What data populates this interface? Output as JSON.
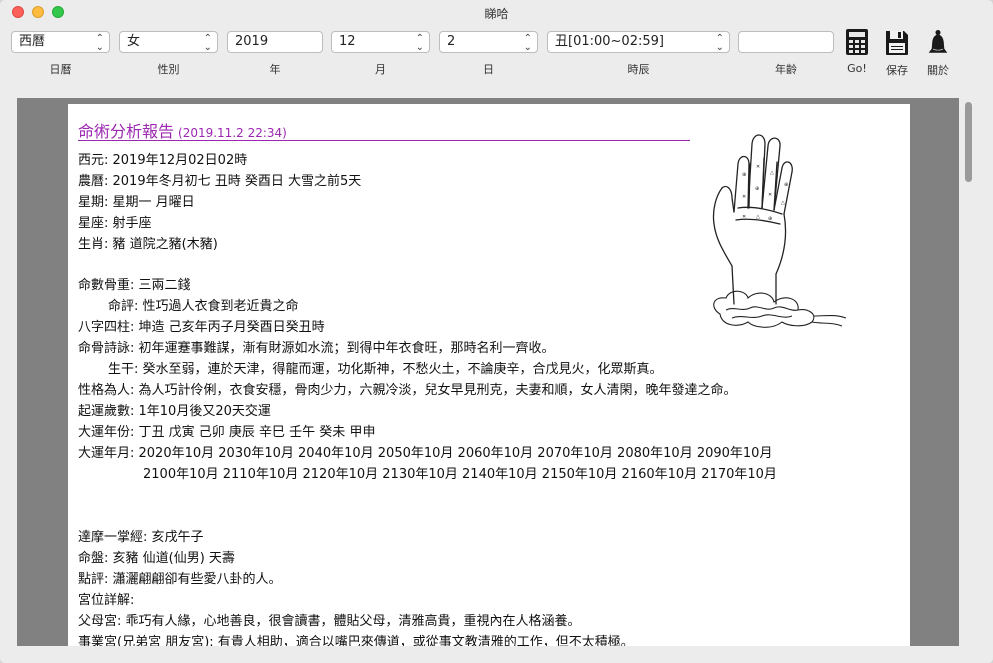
{
  "window": {
    "title": "睇哈"
  },
  "toolbar": {
    "calendar": {
      "value": "西曆",
      "label": "日曆"
    },
    "gender": {
      "value": "女",
      "label": "性別"
    },
    "year": {
      "value": "2019",
      "label": "年"
    },
    "month": {
      "value": "12",
      "label": "月"
    },
    "day": {
      "value": "2",
      "label": "日"
    },
    "hour": {
      "value": "丑[01:00~02:59]",
      "label": "時辰"
    },
    "age": {
      "value": "",
      "label": "年齡"
    },
    "go_label": "Go!",
    "save_label": "保存",
    "about_label": "關於",
    "icons": {
      "go": "calculator-icon",
      "save": "floppy-disk-icon",
      "about": "bell-icon"
    }
  },
  "report": {
    "title": "命術分析報告",
    "date": "(2019.11.2 22:34)",
    "lines": [
      "西元: 2019年12月02日02時",
      "農曆: 2019年冬月初七 丑時 癸酉日 大雪之前5天",
      "星期: 星期一 月曜日",
      "星座: 射手座",
      "生肖: 豬 道院之豬(木豬)",
      "命數骨重: 三兩二錢",
      "命評: 性巧過人衣食到老近貴之命",
      "八字四柱: 坤造 己亥年丙子月癸酉日癸丑時",
      "命骨詩詠: 初年運蹇事難謀，漸有財源如水流；到得中年衣食旺，那時名利一齊收。",
      "生干: 癸水至弱，連於天津，得龍而運，功化斯神，不愁火土，不論庚辛，合戊見火，化眾斯真。",
      "性格為人: 為人巧計伶俐，衣食安穩，骨肉少力，六親冷淡，兒女早見刑克，夫妻和順，女人清閑，晚年發達之命。",
      "起運歲數: 1年10月後又20天交運",
      "大運年份: 丁丑 戊寅 己卯 庚辰 辛巳 壬午 癸未 甲申",
      "大運年月: 2020年10月 2030年10月 2040年10月 2050年10月 2060年10月 2070年10月 2080年10月 2090年10月",
      "2100年10月 2110年10月 2120年10月 2130年10月 2140年10月 2150年10月 2160年10月 2170年10月",
      "達摩一掌經: 亥戌午子",
      "命盤: 亥豬 仙道(仙男) 天壽",
      "點評: 瀟灑翩翩卻有些愛八卦的人。",
      "宮位詳解:",
      "父母宮: 乖巧有人緣，心地善良，很會讀書，體貼父母，清雅高貴，重視內在人格涵養。",
      "事業宮(兄弟宮 朋友宮): 有貴人相助，適合以嘴巴來傳道，或從事文教清雅的工作，但不太積極。"
    ]
  },
  "colors": {
    "accent": "#9c27b0",
    "frame": "#818181"
  }
}
